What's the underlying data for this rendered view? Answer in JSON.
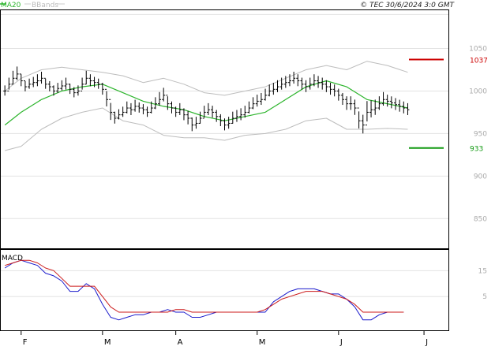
{
  "header": {
    "legend_ma": "MA20",
    "legend_bb": "BBands",
    "copyright": "© TEC 30/6/2024 3:0 GMT"
  },
  "colors": {
    "ma": "#2db52d",
    "bands": "#bdbdbd",
    "bars": "#000000",
    "grid": "#e3e3e3",
    "resistance": "#cc0000",
    "support": "#119911",
    "macd": "#1a1acc",
    "signal": "#cc1a1a"
  },
  "chart_data": [
    {
      "type": "ohlc",
      "yaxis_ticks": [
        1050,
        1000,
        950,
        900,
        850
      ],
      "ylim": [
        815,
        1095
      ],
      "x_months": [
        "F",
        "M",
        "A",
        "M",
        "J",
        "J"
      ],
      "xlim": [
        0,
        110
      ],
      "month_positions": [
        5,
        25,
        43,
        63,
        83,
        104
      ],
      "levels": [
        {
          "name": "resistance",
          "value": 1037,
          "label": "1037"
        },
        {
          "name": "support",
          "value": 933,
          "label": "933"
        }
      ],
      "price": {
        "x": [
          1,
          2,
          3,
          4,
          5,
          6,
          7,
          8,
          9,
          10,
          11,
          12,
          13,
          14,
          15,
          16,
          17,
          18,
          19,
          20,
          21,
          22,
          23,
          24,
          25,
          26,
          27,
          28,
          29,
          30,
          31,
          32,
          33,
          34,
          35,
          36,
          37,
          38,
          39,
          40,
          41,
          42,
          43,
          44,
          45,
          46,
          47,
          48,
          49,
          50,
          51,
          52,
          53,
          54,
          55,
          56,
          57,
          58,
          59,
          60,
          61,
          62,
          63,
          64,
          65,
          66,
          67,
          68,
          69,
          70,
          71,
          72,
          73,
          74,
          75,
          76,
          77,
          78,
          79,
          80,
          81,
          82,
          83,
          84,
          85,
          86,
          87,
          88,
          89,
          90,
          91,
          92,
          93,
          94,
          95,
          96,
          97,
          98,
          99,
          100
        ],
        "close": [
          1000,
          1008,
          1015,
          1020,
          1012,
          1005,
          1008,
          1010,
          1012,
          1015,
          1008,
          1005,
          1000,
          1003,
          1006,
          1008,
          1002,
          998,
          1000,
          1008,
          1015,
          1012,
          1010,
          1008,
          1002,
          990,
          975,
          968,
          972,
          975,
          980,
          978,
          982,
          980,
          978,
          975,
          980,
          985,
          990,
          995,
          985,
          980,
          975,
          978,
          972,
          968,
          960,
          962,
          968,
          975,
          978,
          975,
          970,
          965,
          960,
          962,
          968,
          970,
          972,
          975,
          980,
          985,
          988,
          990,
          995,
          1000,
          1002,
          1005,
          1008,
          1010,
          1012,
          1015,
          1012,
          1008,
          1005,
          1008,
          1012,
          1010,
          1008,
          1005,
          1002,
          1000,
          995,
          990,
          985,
          985,
          980,
          965,
          960,
          975,
          978,
          980,
          985,
          990,
          988,
          986,
          984,
          982,
          980,
          978
        ],
        "range": [
          12,
          14,
          16,
          16,
          14,
          12,
          12,
          12,
          14,
          14,
          12,
          12,
          12,
          12,
          12,
          14,
          12,
          12,
          12,
          14,
          16,
          14,
          12,
          12,
          14,
          18,
          20,
          14,
          12,
          12,
          14,
          14,
          14,
          12,
          12,
          12,
          14,
          14,
          16,
          16,
          16,
          14,
          12,
          14,
          14,
          16,
          16,
          14,
          14,
          14,
          14,
          14,
          14,
          14,
          14,
          14,
          14,
          14,
          14,
          14,
          14,
          14,
          14,
          14,
          14,
          14,
          14,
          14,
          14,
          14,
          14,
          14,
          14,
          14,
          14,
          14,
          14,
          14,
          14,
          14,
          14,
          14,
          14,
          14,
          16,
          16,
          18,
          20,
          22,
          24,
          20,
          18,
          16,
          16,
          14,
          14,
          14,
          14,
          14,
          14
        ]
      },
      "ma20": {
        "x": [
          1,
          5,
          10,
          15,
          20,
          25,
          30,
          35,
          40,
          45,
          50,
          55,
          60,
          65,
          70,
          75,
          80,
          85,
          90,
          95,
          100
        ],
        "y": [
          960,
          975,
          990,
          1000,
          1005,
          1008,
          998,
          988,
          982,
          978,
          970,
          965,
          970,
          975,
          990,
          1005,
          1012,
          1005,
          990,
          985,
          980
        ]
      },
      "bb_upper": {
        "x": [
          1,
          5,
          10,
          15,
          20,
          25,
          30,
          35,
          40,
          45,
          50,
          55,
          60,
          65,
          70,
          75,
          80,
          85,
          90,
          95,
          100
        ],
        "y": [
          1000,
          1015,
          1025,
          1028,
          1025,
          1022,
          1018,
          1010,
          1015,
          1008,
          998,
          995,
          1000,
          1005,
          1015,
          1025,
          1030,
          1025,
          1035,
          1030,
          1022
        ]
      },
      "bb_lower": {
        "x": [
          1,
          5,
          10,
          15,
          20,
          25,
          30,
          35,
          40,
          45,
          50,
          55,
          60,
          65,
          70,
          75,
          80,
          85,
          90,
          95,
          100
        ],
        "y": [
          930,
          935,
          955,
          968,
          975,
          980,
          965,
          960,
          948,
          945,
          945,
          942,
          948,
          950,
          955,
          965,
          968,
          955,
          955,
          956,
          955
        ]
      }
    },
    {
      "type": "line",
      "title": "MACD",
      "yaxis_ticks": [
        15,
        5
      ],
      "ylim": [
        -8,
        23
      ],
      "series": [
        {
          "key": "macd",
          "x": [
            1,
            3,
            5,
            7,
            9,
            11,
            13,
            15,
            17,
            19,
            21,
            23,
            25,
            27,
            29,
            31,
            33,
            35,
            37,
            39,
            41,
            43,
            45,
            47,
            49,
            51,
            53,
            55,
            57,
            59,
            61,
            63,
            65,
            67,
            69,
            71,
            73,
            75,
            77,
            79,
            81,
            83,
            85,
            87,
            89,
            91,
            93,
            95,
            97,
            99
          ],
          "y": [
            16,
            18,
            19,
            18,
            17,
            14,
            13,
            11,
            7,
            7,
            10,
            8,
            2,
            -3,
            -4,
            -3,
            -2,
            -2,
            -1,
            -1,
            0,
            -1,
            -1,
            -3,
            -3,
            -2,
            -1,
            -1,
            -1,
            -1,
            -1,
            -1,
            -1,
            3,
            5,
            7,
            8,
            8,
            8,
            7,
            6,
            6,
            4,
            1,
            -4,
            -4,
            -2,
            -1,
            -1,
            -1
          ]
        },
        {
          "key": "signal",
          "x": [
            1,
            3,
            5,
            7,
            9,
            11,
            13,
            15,
            17,
            19,
            21,
            23,
            25,
            27,
            29,
            31,
            33,
            35,
            37,
            39,
            41,
            43,
            45,
            47,
            49,
            51,
            53,
            55,
            57,
            59,
            61,
            63,
            65,
            67,
            69,
            71,
            73,
            75,
            77,
            79,
            81,
            83,
            85,
            87,
            89,
            91,
            93,
            95,
            97,
            99
          ],
          "y": [
            17,
            18,
            19,
            19,
            18,
            16,
            15,
            12,
            9,
            9,
            9,
            9,
            5,
            1,
            -1,
            -1,
            -1,
            -1,
            -1,
            -1,
            -1,
            0,
            0,
            -1,
            -1,
            -1,
            -1,
            -1,
            -1,
            -1,
            -1,
            -1,
            0,
            2,
            4,
            5,
            6,
            7,
            7,
            7,
            6,
            5,
            4,
            2,
            -1,
            -1,
            -1,
            -1,
            -1,
            -1
          ]
        }
      ]
    }
  ]
}
